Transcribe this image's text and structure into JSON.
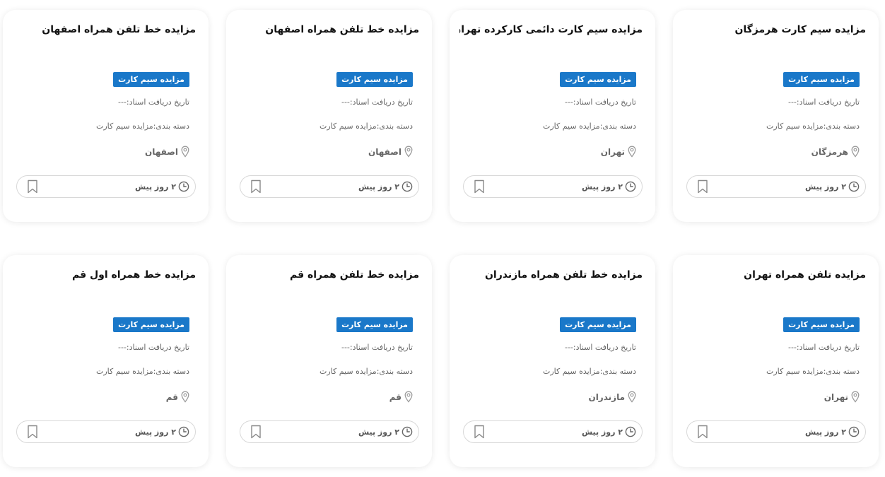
{
  "badge_color": "#1a78c9",
  "icons": {
    "location": "map-pin-icon",
    "time": "clock-icon",
    "save": "bookmark-icon"
  },
  "cards": [
    {
      "title": "مزایده سیم کارت هرمزگان",
      "badge": "مزایده سیم کارت",
      "date": "تاریخ دریافت اسناد:---",
      "category": "دسته بندی:مزایده سیم کارت",
      "location": "هرمزگان",
      "time": "۲ روز پیش"
    },
    {
      "title": "مزایده سیم کارت دائمی کارکرده تهران",
      "badge": "مزایده سیم کارت",
      "date": "تاریخ دریافت اسناد:---",
      "category": "دسته بندی:مزایده سیم کارت",
      "location": "تهران",
      "time": "۲ روز پیش"
    },
    {
      "title": "مزایده خط تلفن همراه اصفهان",
      "badge": "مزایده سیم کارت",
      "date": "تاریخ دریافت اسناد:---",
      "category": "دسته بندی:مزایده سیم کارت",
      "location": "اصفهان",
      "time": "۲ روز پیش"
    },
    {
      "title": "مزایده خط تلفن همراه اصفهان",
      "badge": "مزایده سیم کارت",
      "date": "تاریخ دریافت اسناد:---",
      "category": "دسته بندی:مزایده سیم کارت",
      "location": "اصفهان",
      "time": "۲ روز پیش"
    },
    {
      "title": "مزایده تلفن همراه تهران",
      "badge": "مزایده سیم کارت",
      "date": "تاریخ دریافت اسناد:---",
      "category": "دسته بندی:مزایده سیم کارت",
      "location": "تهران",
      "time": "۲ روز پیش"
    },
    {
      "title": "مزایده خط تلفن همراه مازندران",
      "badge": "مزایده سیم کارت",
      "date": "تاریخ دریافت اسناد:---",
      "category": "دسته بندی:مزایده سیم کارت",
      "location": "مازندران",
      "time": "۲ روز پیش"
    },
    {
      "title": "مزایده خط تلفن همراه قم",
      "badge": "مزایده سیم کارت",
      "date": "تاریخ دریافت اسناد:---",
      "category": "دسته بندی:مزایده سیم کارت",
      "location": "قم",
      "time": "۲ روز پیش"
    },
    {
      "title": "مزایده خط همراه اول قم",
      "badge": "مزایده سیم کارت",
      "date": "تاریخ دریافت اسناد:---",
      "category": "دسته بندی:مزایده سیم کارت",
      "location": "قم",
      "time": "۲ روز پیش"
    }
  ]
}
